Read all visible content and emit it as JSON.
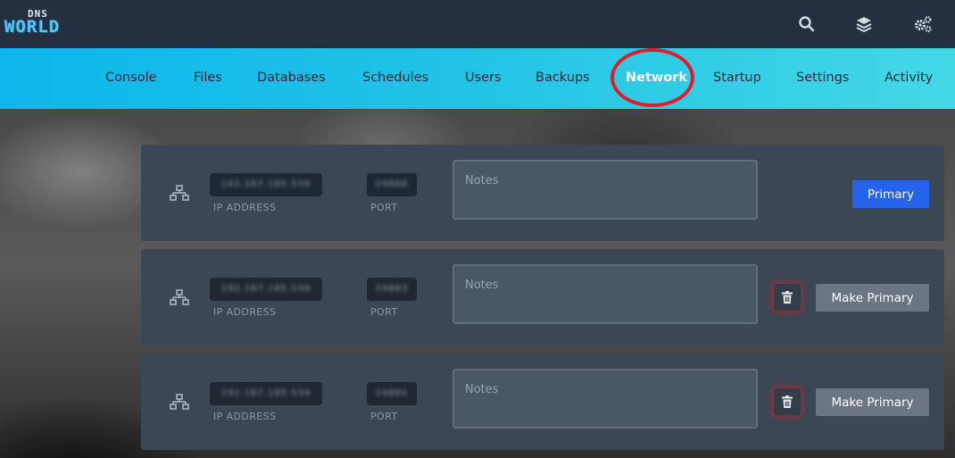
{
  "brand": {
    "small": "DNS",
    "big": "WORLD"
  },
  "header_icons": [
    "search-icon",
    "layers-icon",
    "gears-icon"
  ],
  "nav": {
    "items": [
      {
        "label": "Console"
      },
      {
        "label": "Files"
      },
      {
        "label": "Databases"
      },
      {
        "label": "Schedules"
      },
      {
        "label": "Users"
      },
      {
        "label": "Backups"
      },
      {
        "label": "Network",
        "active": true
      },
      {
        "label": "Startup"
      },
      {
        "label": "Settings"
      },
      {
        "label": "Activity"
      }
    ]
  },
  "allocations": [
    {
      "ip": "192.167.185.539",
      "port": "24888",
      "ip_label": "IP ADDRESS",
      "port_label": "PORT",
      "notes_placeholder": "Notes",
      "button_label": "Primary",
      "is_primary": true
    },
    {
      "ip": "192.167.185.539",
      "port": "24883",
      "ip_label": "IP ADDRESS",
      "port_label": "PORT",
      "notes_placeholder": "Notes",
      "button_label": "Make Primary",
      "is_primary": false
    },
    {
      "ip": "192.167.185.539",
      "port": "24882",
      "ip_label": "IP ADDRESS",
      "port_label": "PORT",
      "notes_placeholder": "Notes",
      "button_label": "Make Primary",
      "is_primary": false
    }
  ],
  "colors": {
    "accent": "#2563eb",
    "nav_gradient_start": "#0db6ec",
    "nav_gradient_end": "#43d8e6",
    "highlight_circle": "#e01e2a"
  }
}
